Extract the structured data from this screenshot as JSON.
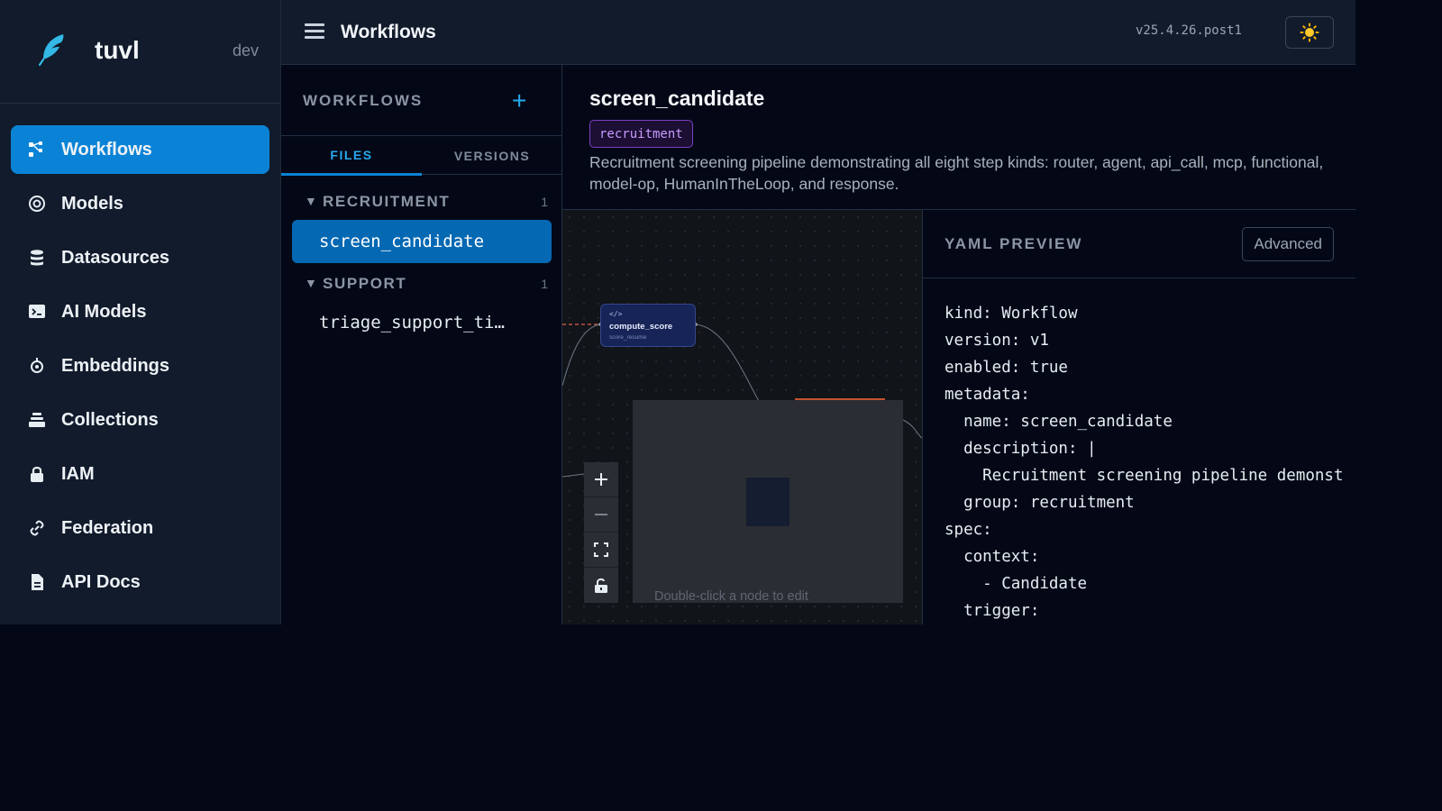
{
  "brand": {
    "name": "tuvl",
    "env": "dev"
  },
  "sidebar": {
    "items": [
      {
        "label": "Workflows",
        "icon": "workflows-icon",
        "active": true
      },
      {
        "label": "Models",
        "icon": "target-icon"
      },
      {
        "label": "Datasources",
        "icon": "database-icon"
      },
      {
        "label": "AI Models",
        "icon": "terminal-icon"
      },
      {
        "label": "Embeddings",
        "icon": "embeddings-icon"
      },
      {
        "label": "Collections",
        "icon": "layers-icon"
      },
      {
        "label": "IAM",
        "icon": "lock-icon"
      },
      {
        "label": "Federation",
        "icon": "link-icon"
      },
      {
        "label": "API Docs",
        "icon": "document-icon"
      }
    ]
  },
  "header": {
    "title": "Workflows",
    "version": "v25.4.26.post1",
    "theme_icon": "sun-icon"
  },
  "workflows_panel": {
    "heading": "WORKFLOWS",
    "add_label": "+",
    "tabs": [
      {
        "label": "FILES",
        "active": true
      },
      {
        "label": "VERSIONS"
      }
    ],
    "groups": [
      {
        "label": "RECRUITMENT",
        "count": "1",
        "items": [
          "screen_candidate"
        ]
      },
      {
        "label": "SUPPORT",
        "count": "1",
        "items": [
          "triage_support_ti…"
        ]
      }
    ]
  },
  "detail": {
    "title": "screen_candidate",
    "tag": "recruitment",
    "description": "Recruitment screening pipeline demonstrating all eight step kinds: router, agent, api_call, mcp, functional, model-op, HumanInTheLoop, and response."
  },
  "canvas": {
    "node": {
      "icon": "</>",
      "title": "compute_score",
      "subtitle": "score_resume"
    },
    "hint": "Double-click a node to edit",
    "controls": [
      "zoom-in",
      "zoom-out",
      "fit-view",
      "lock"
    ]
  },
  "yaml_preview": {
    "heading": "YAML PREVIEW",
    "advanced_label": "Advanced",
    "lines": [
      "kind: Workflow",
      "version: v1",
      "enabled: true",
      "metadata:",
      "  name: screen_candidate",
      "  description: |",
      "    Recruitment screening pipeline demonst",
      "  group: recruitment",
      "spec:",
      "  context:",
      "    - Candidate",
      "  trigger:"
    ]
  },
  "colors": {
    "accent": "#0a83d6",
    "tag": "#c79bff",
    "background": "#040816",
    "sidebar": "#111b2c"
  }
}
